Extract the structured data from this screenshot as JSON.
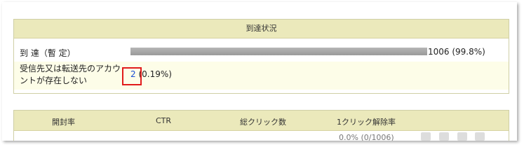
{
  "delivery": {
    "header": "到達状況",
    "reached_label": "到 達（暫 定）",
    "reached_value": "1006 (99.8%)",
    "reached_fraction": 0.998,
    "undeliverable_label": "受信先又は転送先のアカウントが存在しない",
    "undeliverable_count": "2",
    "undeliverable_percent": "(0.19%)"
  },
  "stats": {
    "columns": [
      "開封率",
      "CTR",
      "総クリック数",
      "1クリック解除率"
    ],
    "partial_value": "0.0% (0/1006)"
  }
}
